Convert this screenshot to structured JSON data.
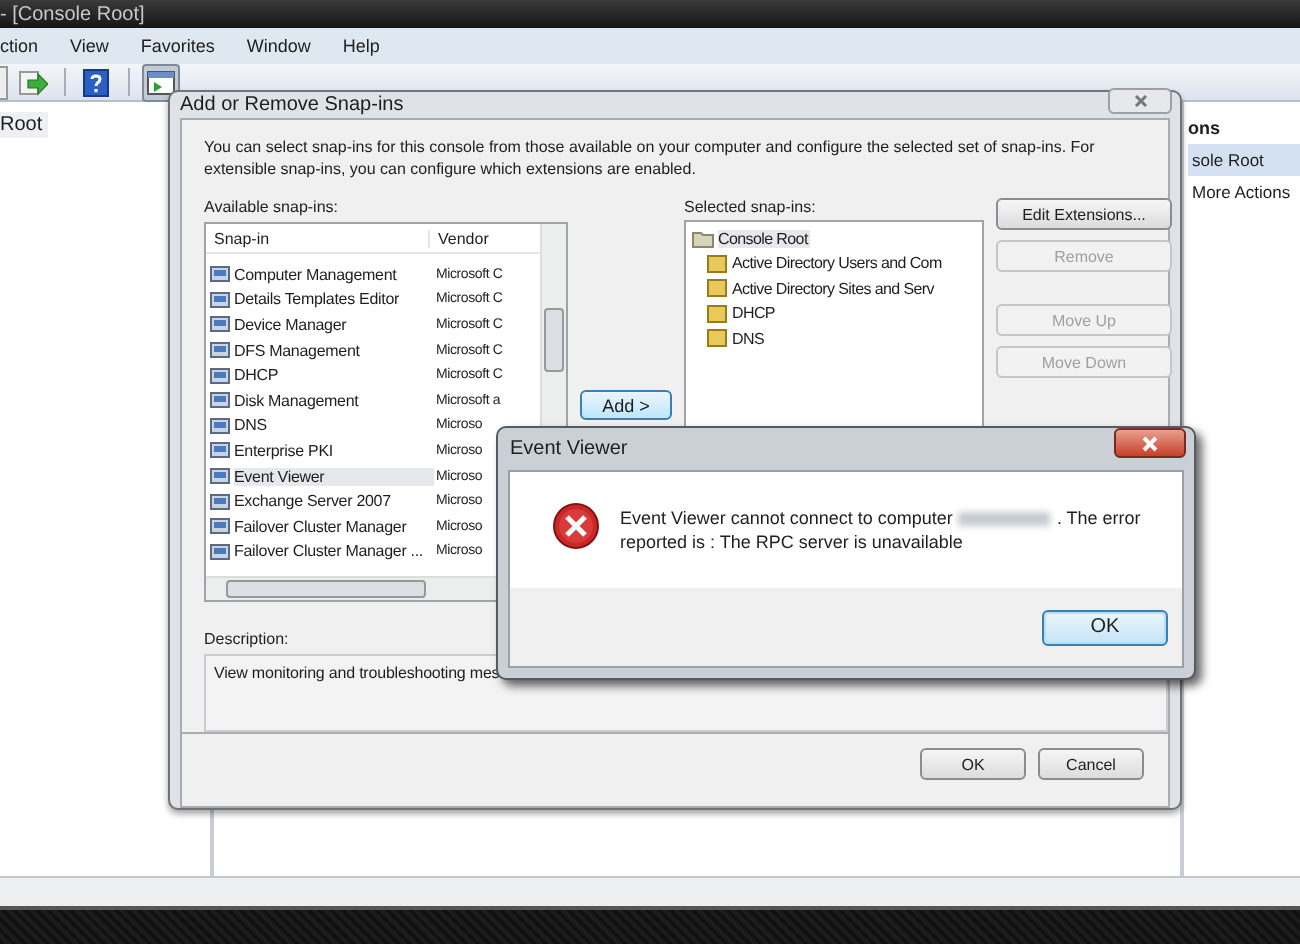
{
  "mmc": {
    "title": "- [Console Root]",
    "menu": [
      "ction",
      "View",
      "Favorites",
      "Window",
      "Help"
    ],
    "toolbar": [
      {
        "kind": "export",
        "pressed": false
      },
      {
        "kind": "help",
        "pressed": false
      },
      {
        "kind": "pane",
        "pressed": true
      }
    ],
    "tree": [
      "Root"
    ],
    "actions": {
      "header": "ons",
      "items": [
        {
          "label": "sole Root",
          "selected": true
        },
        {
          "label": "More Actions",
          "selected": false
        }
      ]
    }
  },
  "snapin_dialog": {
    "title": "Add or Remove Snap-ins",
    "intro": "You can select snap-ins for this console from those available on your computer and configure the selected set of snap-ins. For extensible snap-ins, you can configure which extensions are enabled.",
    "available_label": "Available snap-ins:",
    "columns": [
      "Snap-in",
      "Vendor"
    ],
    "rows": [
      {
        "name": "Computer Management",
        "vendor": "Microsoft C",
        "selected": false
      },
      {
        "name": "Details Templates Editor",
        "vendor": "Microsoft C",
        "selected": false
      },
      {
        "name": "Device Manager",
        "vendor": "Microsoft C",
        "selected": false
      },
      {
        "name": "DFS Management",
        "vendor": "Microsoft C",
        "selected": false
      },
      {
        "name": "DHCP",
        "vendor": "Microsoft C",
        "selected": false
      },
      {
        "name": "Disk Management",
        "vendor": "Microsoft a",
        "selected": false
      },
      {
        "name": "DNS",
        "vendor": "Microso",
        "selected": false
      },
      {
        "name": "Enterprise PKI",
        "vendor": "Microso",
        "selected": false
      },
      {
        "name": "Event Viewer",
        "vendor": "Microso",
        "selected": true
      },
      {
        "name": "Exchange Server 2007",
        "vendor": "Microso",
        "selected": false
      },
      {
        "name": "Failover Cluster Manager",
        "vendor": "Microso",
        "selected": false
      },
      {
        "name": "Failover Cluster Manager ...",
        "vendor": "Microso",
        "selected": false
      }
    ],
    "add_button": "Add >",
    "selected_label": "Selected snap-ins:",
    "selected_tree": [
      {
        "label": "Console Root",
        "selected": true,
        "children": [
          {
            "label": "Active Directory Users and Com",
            "selected": false
          },
          {
            "label": "Active Directory Sites and Serv",
            "selected": false
          },
          {
            "label": "DHCP",
            "selected": false
          },
          {
            "label": "DNS",
            "selected": false
          }
        ]
      }
    ],
    "side_buttons": [
      {
        "label": "Edit Extensions...",
        "disabled": false
      },
      {
        "label": "Remove",
        "disabled": true
      },
      {
        "label": "Move Up",
        "disabled": true
      },
      {
        "label": "Move Down",
        "disabled": true
      }
    ],
    "description_label": "Description:",
    "description": "View monitoring and troubleshooting mes",
    "buttons": [
      {
        "label": "OK",
        "default": false
      },
      {
        "label": "Cancel",
        "default": false
      }
    ]
  },
  "error_dialog": {
    "title": "Event Viewer",
    "message_start": "Event Viewer cannot connect to computer",
    "message_after_name": ". The error",
    "message_line2": "reported is : The RPC server is unavailable",
    "buttons": [
      {
        "label": "OK",
        "default": true
      }
    ]
  }
}
